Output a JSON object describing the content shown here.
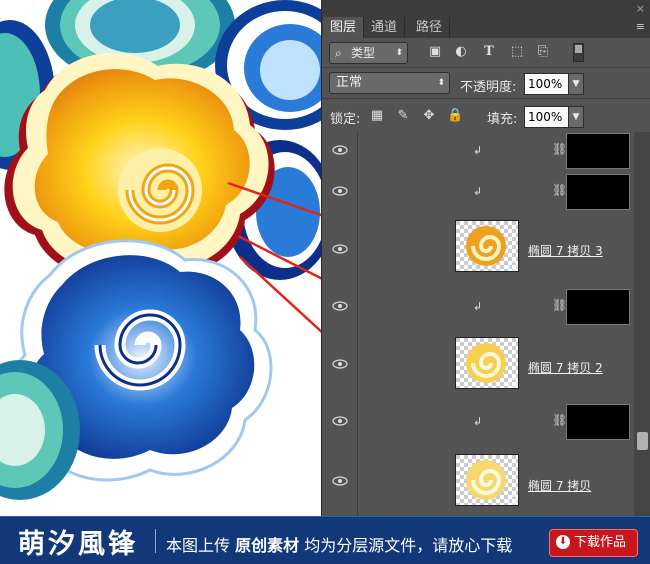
{
  "panel": {
    "tabs": [
      "图层",
      "通道",
      "路径"
    ],
    "close_icon": "×",
    "menu_icon": "≡",
    "filter_kind_label": "类型",
    "blend_mode": "正常",
    "opacity_label": "不透明度:",
    "opacity_value": "100%",
    "lock_label": "锁定:",
    "fill_label": "填充:",
    "fill_value": "100%"
  },
  "layers": [
    {
      "type": "clip-mask"
    },
    {
      "type": "clip-mask"
    },
    {
      "type": "shape",
      "name": "椭圆 7 拷贝 3",
      "thumb_color": "#f0a020"
    },
    {
      "type": "clip-mask"
    },
    {
      "type": "shape",
      "name": "椭圆 7 拷贝 2",
      "thumb_color": "#f8d050"
    },
    {
      "type": "clip-mask"
    },
    {
      "type": "shape",
      "name": "椭圆 7 拷贝",
      "thumb_color": "#f5d870"
    }
  ],
  "footer": {
    "brand": "萌汐風锋",
    "text_prefix": "本图上传",
    "text_bold": "原创素材",
    "text_suffix": "均为分层源文件，请放心下载",
    "download_label": "下载作品"
  },
  "colors": {
    "panel_bg": "#535353",
    "annotation_line": "#e0251b",
    "footer_bg": "#12387a",
    "download_bg": "#c8161d"
  }
}
